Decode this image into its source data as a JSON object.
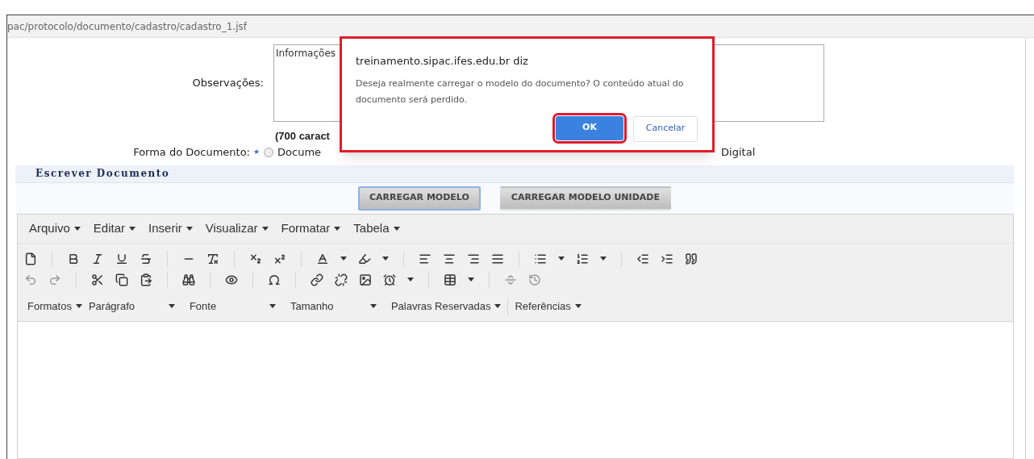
{
  "address_bar": {
    "url": "pac/protocolo/documento/cadastro/cadastro_1.jsf"
  },
  "form": {
    "observacoes": {
      "label": "Observações:",
      "value": "Informações"
    },
    "char_note": "(700 caract",
    "forma": {
      "label": "Forma do Documento:",
      "required_mark": "★",
      "options": [
        {
          "label": "Docume",
          "selected": false
        },
        {
          "label": "Digital"
        }
      ]
    }
  },
  "section": {
    "title": "Escrever Documento"
  },
  "buttons": [
    {
      "label": "CARREGAR MODELO",
      "focused": true
    },
    {
      "label": "CARREGAR MODELO UNIDADE",
      "focused": false
    }
  ],
  "editor": {
    "menus": [
      "Arquivo",
      "Editar",
      "Inserir",
      "Visualizar",
      "Formatar",
      "Tabela"
    ],
    "format_bar": [
      {
        "label": "Formatos",
        "kind": "menu"
      },
      {
        "label": "Parágrafo",
        "kind": "listbox"
      },
      {
        "label": "Fonte",
        "kind": "listbox"
      },
      {
        "label": "Tamanho",
        "kind": "listbox"
      },
      {
        "label": "Palavras Reservadas",
        "kind": "menu"
      },
      {
        "label": "Referências",
        "kind": "menu"
      }
    ]
  },
  "dialog": {
    "title": "treinamento.sipac.ifes.edu.br diz",
    "message": "Deseja realmente carregar o modelo do documento? O conteúdo atual do documento será perdido.",
    "annotated": true,
    "buttons": [
      {
        "label": "OK",
        "kind": "primary",
        "annotated": true
      },
      {
        "label": "Cancelar",
        "kind": "secondary",
        "annotated": false
      }
    ]
  }
}
